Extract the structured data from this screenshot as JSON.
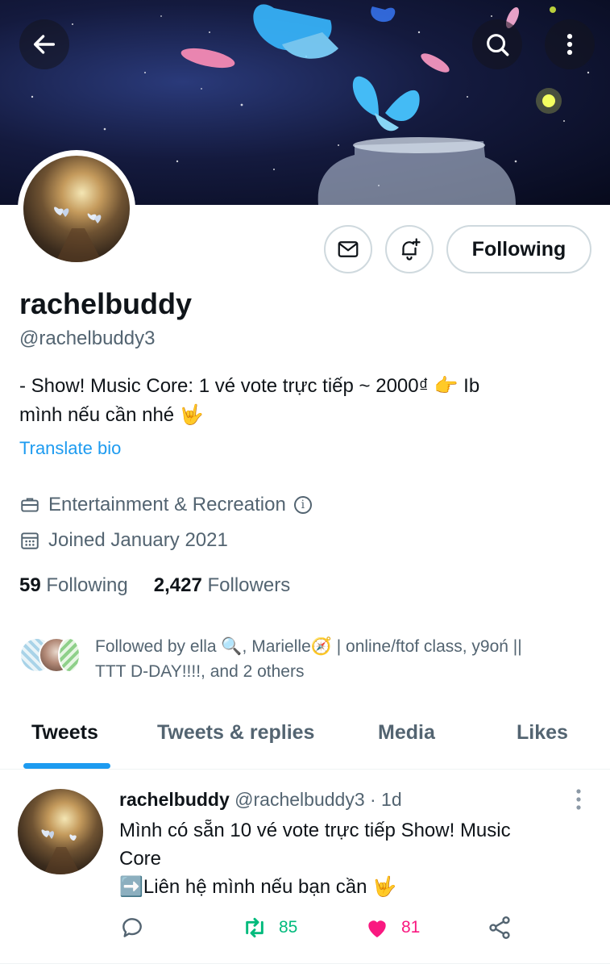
{
  "profile": {
    "display_name": "rachelbuddy",
    "handle": "@rachelbuddy3",
    "bio_line1": "- Show! Music Core:  1 vé vote trực tiếp ~ 2000₫ 👉 Ib",
    "bio_line2": "mình nếu cần nhé 🤟",
    "translate_label": "Translate bio",
    "category": "Entertainment & Recreation",
    "joined": "Joined January 2021",
    "following_count": "59",
    "following_label": "Following",
    "followers_count": "2,427",
    "followers_label": "Followers",
    "followed_by_line1": "Followed by ella 🔍, Marielle🧭 | online/ftof class, y9oń ||",
    "followed_by_line2": "TTT D-DAY!!!!, and 2 others"
  },
  "header": {
    "back_icon": "arrow-left-icon",
    "search_icon": "search-icon",
    "more_icon": "more-vertical-icon",
    "message_icon": "mail-icon",
    "notify_icon": "bell-plus-icon",
    "follow_button_label": "Following"
  },
  "tabs": [
    {
      "label": "Tweets",
      "active": true
    },
    {
      "label": "Tweets & replies",
      "active": false
    },
    {
      "label": "Media",
      "active": false
    },
    {
      "label": "Likes",
      "active": false
    }
  ],
  "tweet": {
    "name": "rachelbuddy",
    "handle_time": "@rachelbuddy3 · 1d",
    "text_line1": "Mình có sẵn 10 vé vote trực tiếp Show! Music",
    "text_line2": "Core",
    "text_line3": "➡️Liên hệ mình nếu bạn cần 🤟",
    "retweet_count": "85",
    "like_count": "81",
    "liked": true
  },
  "colors": {
    "accent": "#1d9bf0",
    "retweet": "#00ba7c",
    "like": "#f91880",
    "secondary_text": "#536471"
  }
}
